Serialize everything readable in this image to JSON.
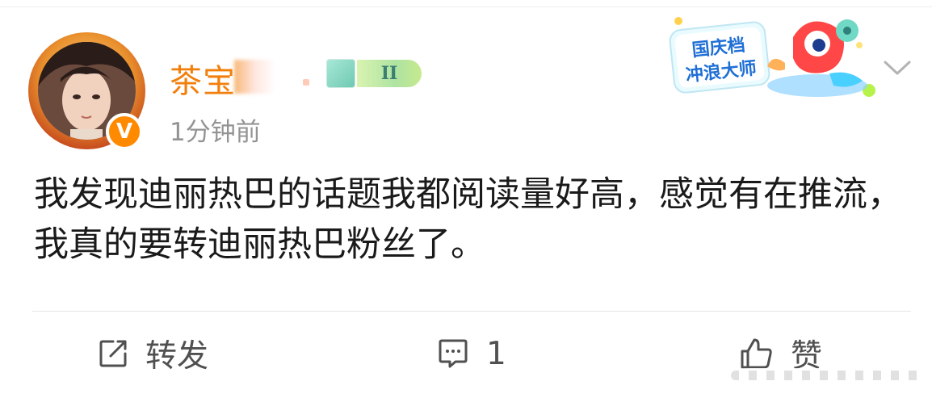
{
  "post": {
    "username": "茶宝",
    "member_badge_label": "II",
    "timestamp": "1分钟前",
    "verified_label": "V",
    "text": "我发现迪丽热巴的话题我都阅读量好高，感觉有在推流，我真的要转迪丽热巴粉丝了。"
  },
  "promo": {
    "line1": "国庆档",
    "line2": "冲浪大师"
  },
  "actions": {
    "repost_label": "转发",
    "comment_count": "1",
    "like_label": "赞"
  },
  "icons": {
    "repost": "repost-icon",
    "comment": "comment-icon",
    "like": "thumbs-up-icon",
    "dropdown": "chevron-down-icon"
  },
  "colors": {
    "username": "#f27f0c",
    "verified": "#ff8a00",
    "timestamp": "#939393",
    "body_text": "#1a1a1a",
    "action_text": "#505050"
  }
}
